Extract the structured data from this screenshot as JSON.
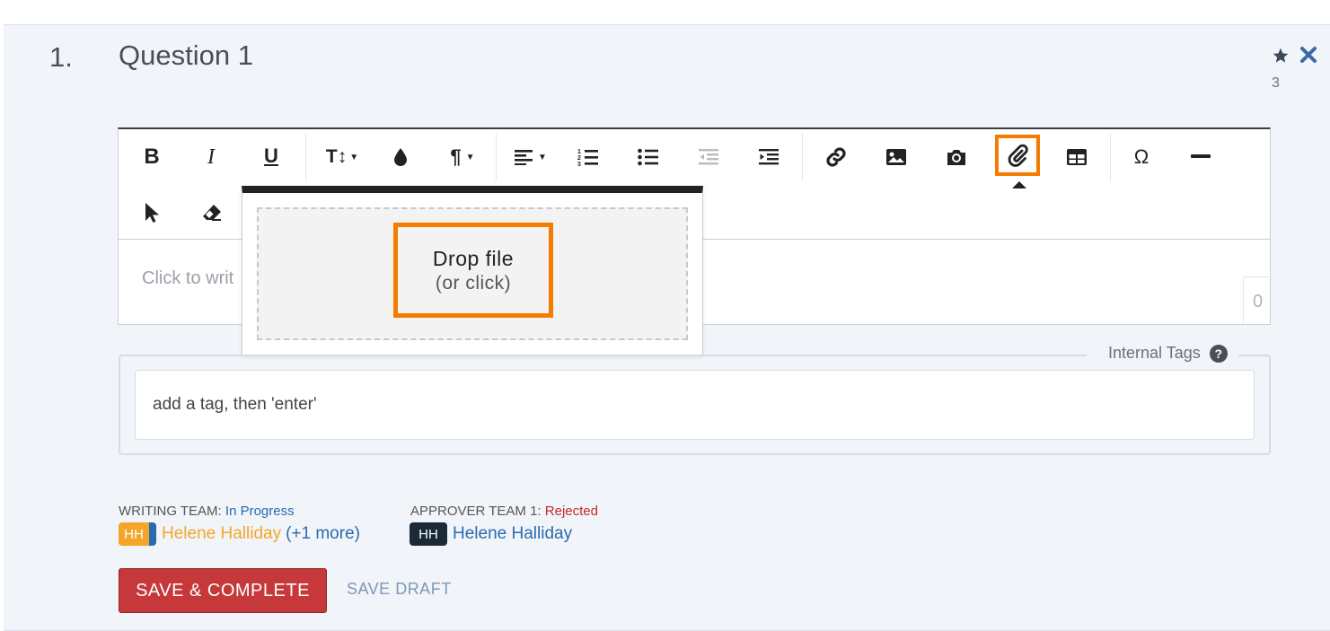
{
  "question": {
    "number": "1.",
    "title": "Question 1",
    "star_count": "3"
  },
  "editor": {
    "placeholder": "Click to writ",
    "char_count": "0",
    "toolbar": {
      "row1": [
        "bold-icon",
        "italic-icon",
        "underline-icon",
        "font-size-icon",
        "color-drop-icon",
        "paragraph-icon",
        "align-left-icon",
        "ordered-list-icon",
        "unordered-list-icon",
        "outdent-icon",
        "indent-icon",
        "link-icon",
        "image-icon",
        "camera-icon",
        "paperclip-icon",
        "table-icon",
        "omega-icon",
        "horizontal-rule-icon"
      ],
      "row2": [
        "cursor-icon",
        "eraser-icon"
      ],
      "text_labels": {
        "bold": "B",
        "italic": "I",
        "underline": "U",
        "font_size": "T↕",
        "paragraph": "¶",
        "omega": "Ω"
      }
    }
  },
  "popup": {
    "drop_label": "Drop file",
    "drop_sub": "(or click)"
  },
  "tags": {
    "legend": "Internal Tags",
    "help": "?",
    "placeholder": "add a tag, then 'enter'"
  },
  "teams": {
    "writing": {
      "label": "WRITING TEAM:",
      "status": "In Progress",
      "initials": "HH",
      "member": "Helene Halliday",
      "more": "(+1 more)"
    },
    "approver": {
      "label": "APPROVER TEAM 1:",
      "status": "Rejected",
      "initials": "HH",
      "member": "Helene Halliday"
    }
  },
  "actions": {
    "save_complete": "SAVE & COMPLETE",
    "save_draft": "SAVE DRAFT"
  },
  "colors": {
    "highlight": "#f57c00",
    "save": "#c7383a",
    "in_progress": "#2a6bb0",
    "rejected": "#c62828"
  }
}
